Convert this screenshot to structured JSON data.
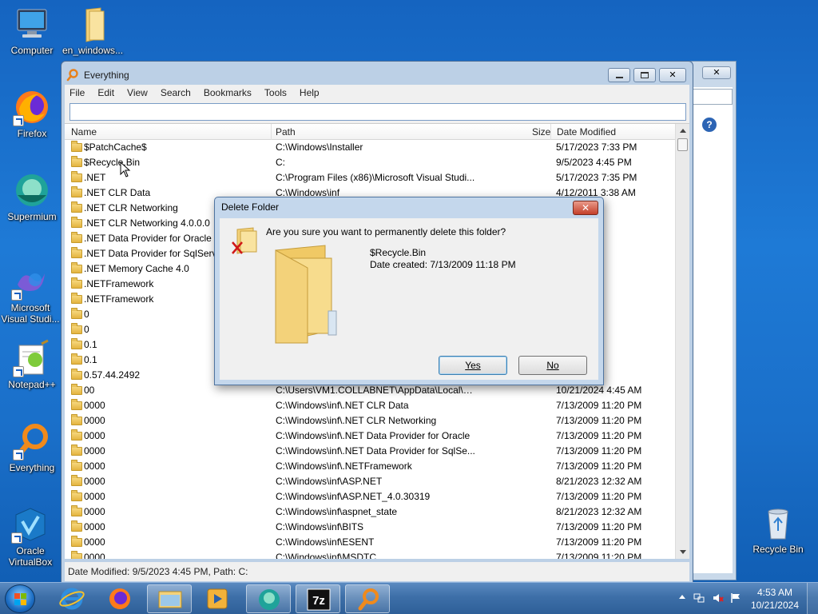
{
  "desktop": {
    "icons": [
      {
        "label": "Computer"
      },
      {
        "label": "en_windows..."
      },
      {
        "label": "Firefox"
      },
      {
        "label": "Supermium"
      },
      {
        "label": "Microsoft Visual Studi..."
      },
      {
        "label": "Notepad++"
      },
      {
        "label": "Everything"
      },
      {
        "label": "Oracle VirtualBox"
      },
      {
        "label": "Recycle Bin"
      }
    ]
  },
  "window": {
    "title": "Everything",
    "menu": [
      "File",
      "Edit",
      "View",
      "Search",
      "Bookmarks",
      "Tools",
      "Help"
    ],
    "search_value": "",
    "columns": {
      "name": "Name",
      "path": "Path",
      "size": "Size",
      "date": "Date Modified"
    },
    "rows": [
      {
        "name": "$PatchCache$",
        "path": "C:\\Windows\\Installer",
        "date": "5/17/2023 7:33 PM"
      },
      {
        "name": "$Recycle.Bin",
        "path": "C:",
        "date": "9/5/2023 4:45 PM"
      },
      {
        "name": ".NET",
        "path": "C:\\Program Files (x86)\\Microsoft Visual Studi...",
        "date": "5/17/2023 7:35 PM"
      },
      {
        "name": ".NET CLR Data",
        "path": "C:\\Windows\\inf",
        "date": "4/12/2011 3:38 AM"
      },
      {
        "name": ".NET CLR Networking",
        "path": "",
        "date": "7:33 PM"
      },
      {
        "name": ".NET CLR Networking 4.0.0.0",
        "path": "",
        "date": "3:38 AM"
      },
      {
        "name": ".NET Data Provider for Oracle",
        "path": "",
        "date": "3:38 AM"
      },
      {
        "name": ".NET Data Provider for SqlServer",
        "path": "",
        "date": "3:38 AM"
      },
      {
        "name": ".NET Memory Cache 4.0",
        "path": "",
        "date": "7:33 PM"
      },
      {
        "name": ".NETFramework",
        "path": "",
        "date": "7:34 PM"
      },
      {
        "name": ".NETFramework",
        "path": "",
        "date": "3:38 AM"
      },
      {
        "name": "0",
        "path": "",
        "date": "7:35 PM"
      },
      {
        "name": "0",
        "path": "",
        "date": "4:16 AM"
      },
      {
        "name": "0.1",
        "path": "",
        "date": "4:38 PM"
      },
      {
        "name": "0.1",
        "path": "",
        "date": "4:16 AM"
      },
      {
        "name": "0.57.44.2492",
        "path": "",
        "date": "7:33 PM"
      },
      {
        "name": "00",
        "path": "C:\\Users\\VM1.COLLABNET\\AppData\\Local\\S...",
        "date": "10/21/2024 4:45 AM"
      },
      {
        "name": "0000",
        "path": "C:\\Windows\\inf\\.NET CLR Data",
        "date": "7/13/2009 11:20 PM"
      },
      {
        "name": "0000",
        "path": "C:\\Windows\\inf\\.NET CLR Networking",
        "date": "7/13/2009 11:20 PM"
      },
      {
        "name": "0000",
        "path": "C:\\Windows\\inf\\.NET Data Provider for Oracle",
        "date": "7/13/2009 11:20 PM"
      },
      {
        "name": "0000",
        "path": "C:\\Windows\\inf\\.NET Data Provider for SqlSe...",
        "date": "7/13/2009 11:20 PM"
      },
      {
        "name": "0000",
        "path": "C:\\Windows\\inf\\.NETFramework",
        "date": "7/13/2009 11:20 PM"
      },
      {
        "name": "0000",
        "path": "C:\\Windows\\inf\\ASP.NET",
        "date": "8/21/2023 12:32 AM"
      },
      {
        "name": "0000",
        "path": "C:\\Windows\\inf\\ASP.NET_4.0.30319",
        "date": "7/13/2009 11:20 PM"
      },
      {
        "name": "0000",
        "path": "C:\\Windows\\inf\\aspnet_state",
        "date": "8/21/2023 12:32 AM"
      },
      {
        "name": "0000",
        "path": "C:\\Windows\\inf\\BITS",
        "date": "7/13/2009 11:20 PM"
      },
      {
        "name": "0000",
        "path": "C:\\Windows\\inf\\ESENT",
        "date": "7/13/2009 11:20 PM"
      },
      {
        "name": "0000",
        "path": "C:\\Windows\\inf\\MSDTC",
        "date": "7/13/2009 11:20 PM"
      }
    ],
    "status": "Date Modified: 9/5/2023 4:45 PM, Path: C:"
  },
  "dialog": {
    "title": "Delete Folder",
    "close_label": "✕",
    "question": "Are you sure you want to permanently delete this folder?",
    "folder_name": "$Recycle.Bin",
    "date_created": "Date created: 7/13/2009 11:18 PM",
    "yes_label": "Yes",
    "no_label": "No"
  },
  "taskbar": {
    "time": "4:53 AM",
    "date": "10/21/2024"
  },
  "colors": {
    "desktop_bg": "#1e7ad6",
    "window_frame": "#bcd0e6",
    "dialog_close": "#c4402a"
  }
}
